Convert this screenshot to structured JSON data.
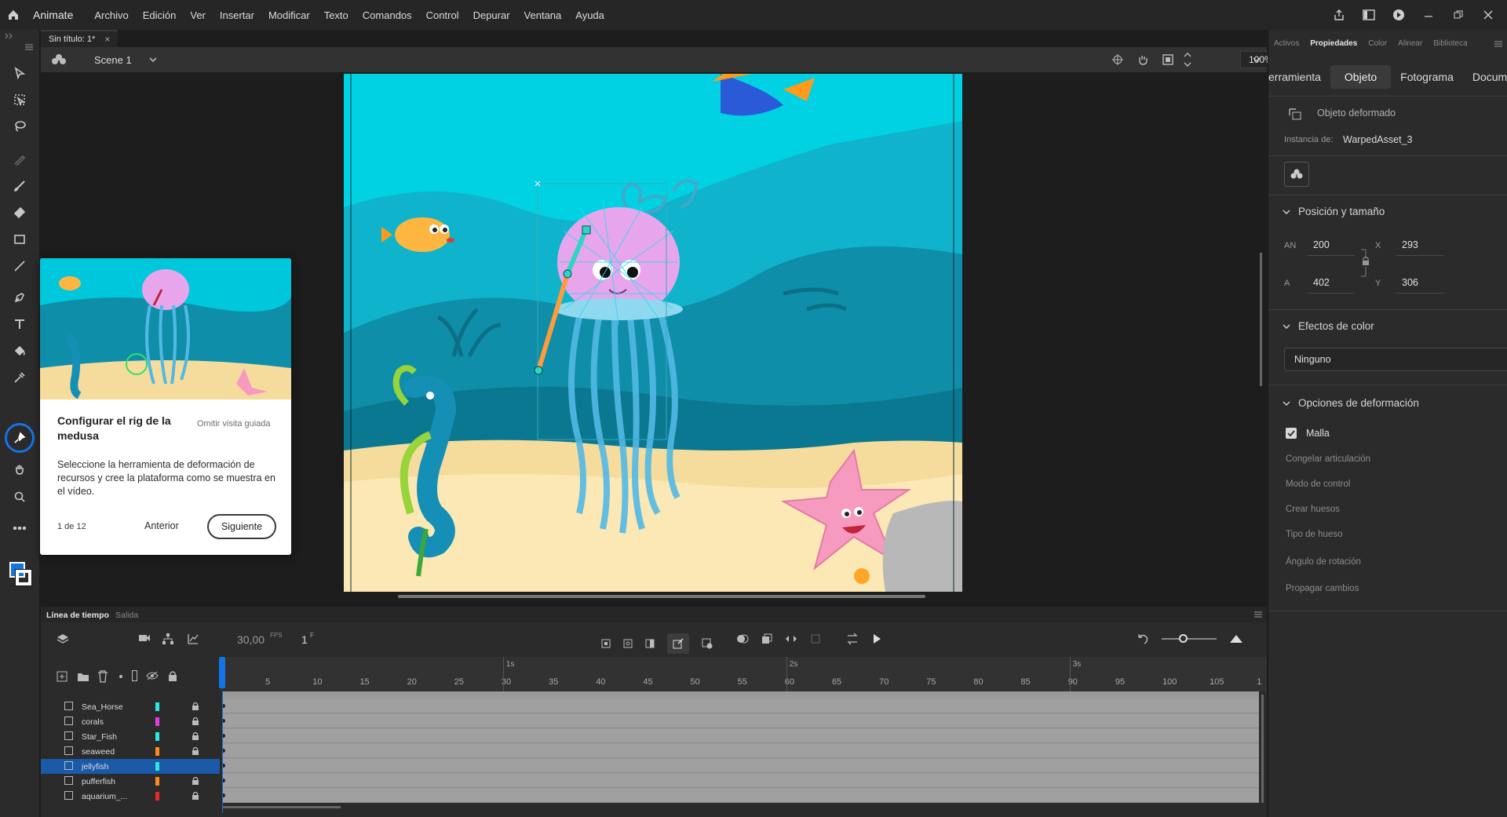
{
  "app": {
    "name": "Animate",
    "menu": [
      "Archivo",
      "Edición",
      "Ver",
      "Insertar",
      "Modificar",
      "Texto",
      "Comandos",
      "Control",
      "Depurar",
      "Ventana",
      "Ayuda"
    ]
  },
  "document": {
    "tab_title": "Sin título: 1*",
    "close": "×"
  },
  "scenebar": {
    "scene": "Scene 1",
    "zoom": "100%"
  },
  "tour": {
    "title": "Configurar el rig de la medusa",
    "skip": "Omitir visita guiada",
    "description": "Seleccione la herramienta de deformación de recursos y cree la plataforma como se muestra en el vídeo.",
    "step": "1 de 12",
    "prev": "Anterior",
    "next": "Siguiente"
  },
  "properties": {
    "panel_tabs": [
      "Activos",
      "Propiedades",
      "Color",
      "Alinear",
      "Biblioteca"
    ],
    "active_panel_tab": "Propiedades",
    "sub_tabs": [
      "erramienta",
      "Objeto",
      "Fotograma",
      "Documen"
    ],
    "active_sub_tab": "Objeto",
    "object_type": "Objeto deformado",
    "instance_label": "Instancia de:",
    "instance_value": "WarpedAsset_3",
    "position_size": {
      "title": "Posición y tamaño",
      "w_label": "AN",
      "w": "200",
      "x_label": "X",
      "x": "293",
      "h_label": "A",
      "h": "402",
      "y_label": "Y",
      "y": "306"
    },
    "color_effects": {
      "title": "Efectos de color",
      "value": "Ninguno"
    },
    "warp_options": {
      "title": "Opciones de deformación",
      "mesh_label": "Malla",
      "mesh_checked": true,
      "items": [
        "Congelar articulación",
        "Modo de control",
        "Crear huesos",
        "Tipo de hueso",
        "Ángulo de rotación",
        "Propagar cambios"
      ]
    }
  },
  "timeline": {
    "tabs": [
      "Línea de tiempo",
      "Salida"
    ],
    "fps": "30,00",
    "fps_unit": "FPS",
    "frame": "1",
    "frame_unit": "F",
    "seconds": [
      "1s",
      "2s",
      "3s"
    ],
    "ticks": [
      "5",
      "10",
      "15",
      "20",
      "25",
      "30",
      "35",
      "40",
      "45",
      "50",
      "55",
      "60",
      "65",
      "70",
      "75",
      "80",
      "85",
      "90",
      "95",
      "100",
      "105",
      "1"
    ],
    "layers": [
      {
        "name": "Sea_Horse",
        "color": "#2ee6e6",
        "locked": true,
        "selected": false
      },
      {
        "name": "corals",
        "color": "#e23fe2",
        "locked": true,
        "selected": false
      },
      {
        "name": "Star_Fish",
        "color": "#2ee6e6",
        "locked": true,
        "selected": false
      },
      {
        "name": "seaweed",
        "color": "#ff8a1a",
        "locked": true,
        "selected": false
      },
      {
        "name": "jellyfish",
        "color": "#2ee6e6",
        "locked": false,
        "selected": true
      },
      {
        "name": "pufferfish",
        "color": "#ff8a1a",
        "locked": true,
        "selected": false
      },
      {
        "name": "aquarium_...",
        "color": "#e82a2a",
        "locked": true,
        "selected": false
      }
    ]
  }
}
